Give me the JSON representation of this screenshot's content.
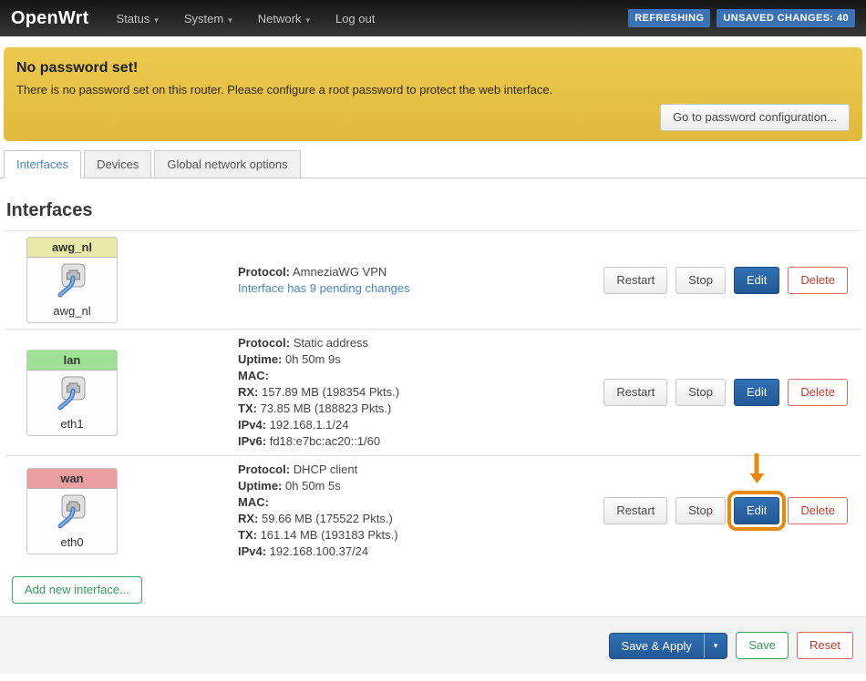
{
  "navbar": {
    "brand": "OpenWrt",
    "caret": "▾",
    "items": [
      {
        "label": "Status",
        "dropdown": true
      },
      {
        "label": "System",
        "dropdown": true
      },
      {
        "label": "Network",
        "dropdown": true
      },
      {
        "label": "Log out",
        "dropdown": false
      }
    ],
    "badges": [
      {
        "label": "REFRESHING"
      },
      {
        "label": "UNSAVED CHANGES: 40"
      }
    ]
  },
  "alert": {
    "title": "No password set!",
    "message": "There is no password set on this router. Please configure a root password to protect the web interface.",
    "action_label": "Go to password configuration..."
  },
  "tabs": [
    {
      "label": "Interfaces",
      "active": true
    },
    {
      "label": "Devices",
      "active": false
    },
    {
      "label": "Global network options",
      "active": false
    }
  ],
  "page_title": "Interfaces",
  "actions": {
    "restart": "Restart",
    "stop": "Stop",
    "edit": "Edit",
    "delete": "Delete"
  },
  "interfaces": [
    {
      "name": "awg_nl",
      "device": "awg_nl",
      "details": [
        {
          "label": "Protocol:",
          "value": "AmneziaWG VPN"
        }
      ],
      "pending_link": "Interface has 9 pending changes"
    },
    {
      "name": "lan",
      "device": "eth1",
      "details": [
        {
          "label": "Protocol:",
          "value": "Static address"
        },
        {
          "label": "Uptime:",
          "value": "0h 50m 9s"
        },
        {
          "label": "MAC:",
          "value": ""
        },
        {
          "label": "RX:",
          "value": "157.89 MB (198354 Pkts.)"
        },
        {
          "label": "TX:",
          "value": "73.85 MB (188823 Pkts.)"
        },
        {
          "label": "IPv4:",
          "value": "192.168.1.1/24"
        },
        {
          "label": "IPv6:",
          "value": "fd18:e7bc:ac20::1/60"
        }
      ]
    },
    {
      "name": "wan",
      "device": "eth0",
      "details": [
        {
          "label": "Protocol:",
          "value": "DHCP client"
        },
        {
          "label": "Uptime:",
          "value": "0h 50m 5s"
        },
        {
          "label": "MAC:",
          "value": ""
        },
        {
          "label": "RX:",
          "value": "59.66 MB (175522 Pkts.)"
        },
        {
          "label": "TX:",
          "value": "161.14 MB (193183 Pkts.)"
        },
        {
          "label": "IPv4:",
          "value": "192.168.100.37/24"
        }
      ]
    }
  ],
  "add_button": "Add new interface...",
  "footer": {
    "save_apply": "Save & Apply",
    "caret": "▾",
    "save": "Save",
    "reset": "Reset"
  },
  "annotation": {
    "target": "wan-edit-button",
    "shape": "arrow-and-ring",
    "color": "#e8890c"
  },
  "colors": {
    "zone_awg_nl": "#e8e8a8",
    "zone_lan": "#9fe295",
    "zone_wan": "#e99f9f",
    "accent_blue": "#2a62a8",
    "badge_blue": "#3a72b5",
    "link_blue": "#4a87c0",
    "danger_red": "#c23d30",
    "success_green": "#349a5b",
    "alert_yellow": "#e7c344",
    "annotation_orange": "#e8890c"
  }
}
